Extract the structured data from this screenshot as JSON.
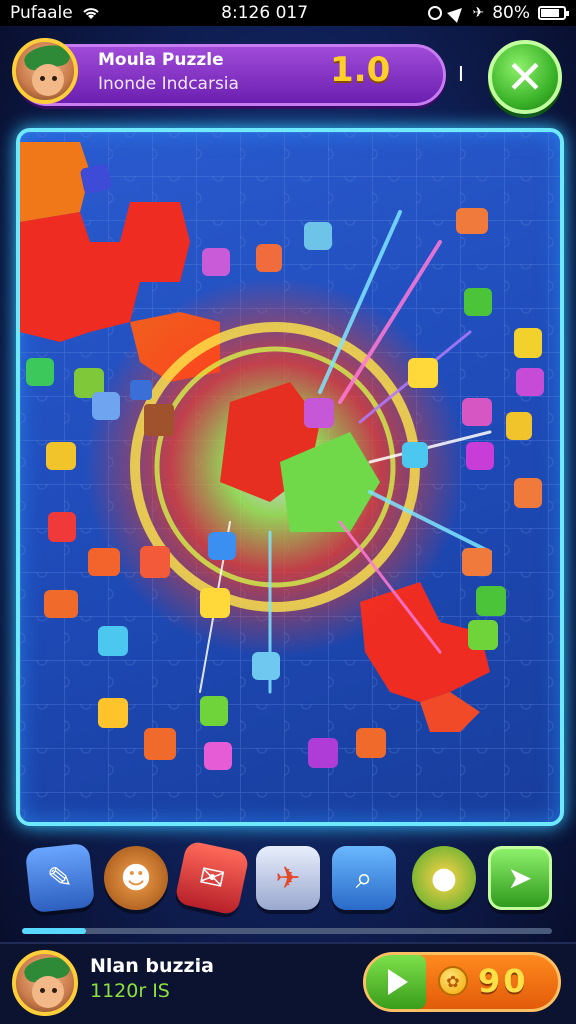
{
  "status_bar": {
    "carrier": "Pufaale",
    "time": "8:126 017",
    "battery_percent": "80%",
    "battery_level": 0.8
  },
  "header": {
    "title": "Moula Puzzle",
    "subtitle": "Inonde Indcarsia",
    "score": "1.0",
    "separator": "I"
  },
  "toolbar": {
    "progress": 0.12,
    "tools": [
      {
        "name": "tool-hint-wand",
        "icon": "wand-icon",
        "color": "#4a86d8"
      },
      {
        "name": "tool-sun",
        "icon": "sun-icon",
        "color": "#c47a2d"
      },
      {
        "name": "tool-tag",
        "icon": "tag-icon",
        "color": "#d93c3c"
      },
      {
        "name": "tool-mail",
        "icon": "envelope-icon",
        "color": "#3b72c6"
      },
      {
        "name": "tool-magnifier",
        "icon": "magnifier-icon",
        "color": "#3a8fd8"
      },
      {
        "name": "tool-chick",
        "icon": "chick-icon",
        "color": "#4ab345"
      },
      {
        "name": "tool-rocket",
        "icon": "rocket-icon",
        "color": "#5ccf3e"
      }
    ]
  },
  "footer": {
    "name": "Nlan buzzia",
    "sub": "1120r IS",
    "coins": "90"
  },
  "colors": {
    "accent_purple": "#7a2fc0",
    "accent_green": "#3cb52a",
    "board_glow": "#6fe9ff",
    "coin_gold": "#ffd02b"
  }
}
